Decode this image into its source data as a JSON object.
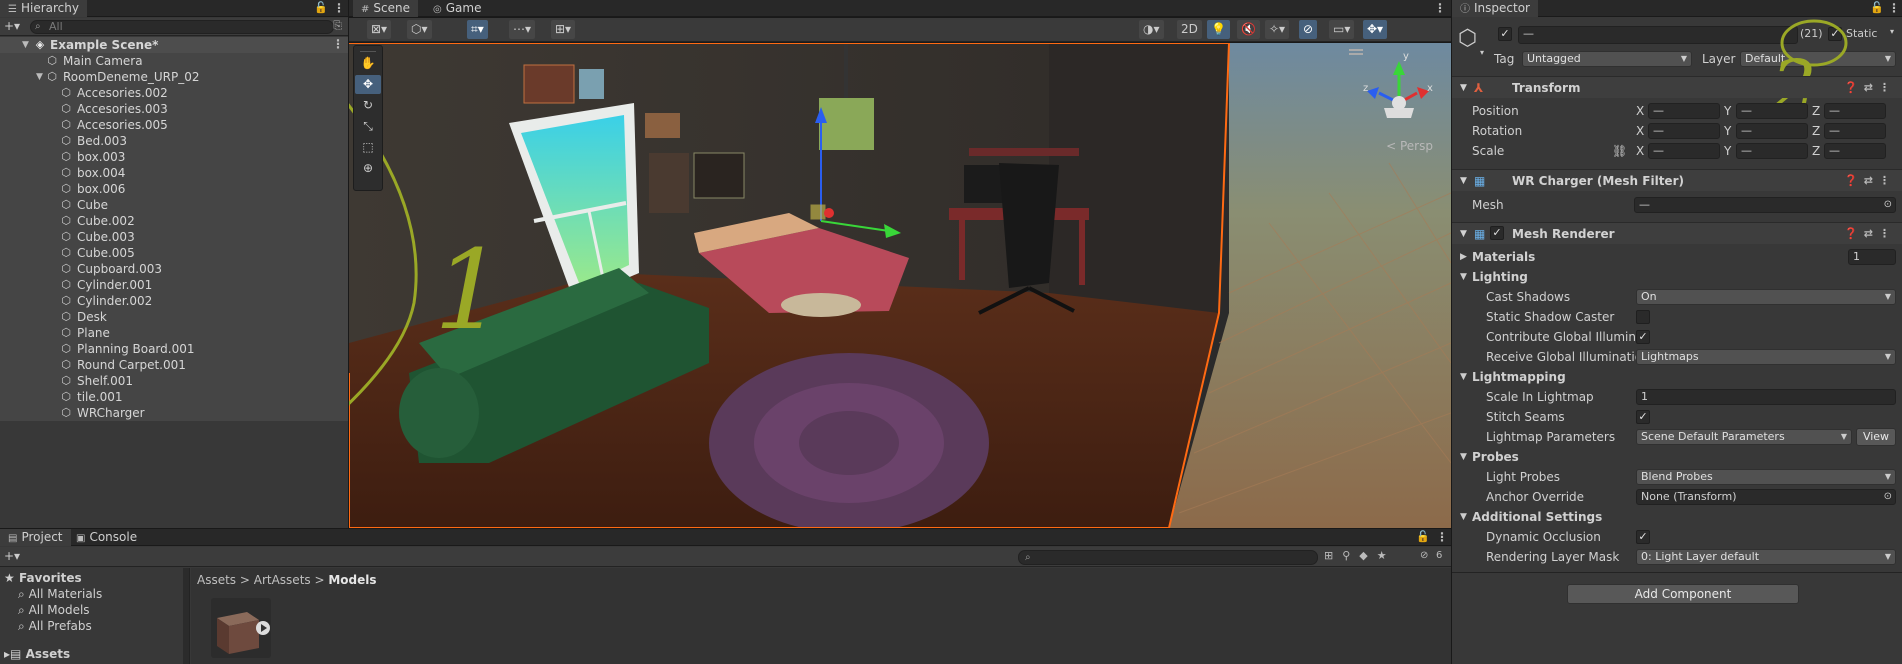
{
  "colors": {
    "accent": "#46607c",
    "selection_outline": "#ff6a13",
    "annotation": "#9aa826"
  },
  "hierarchy": {
    "tab": "Hierarchy",
    "search_placeholder": "All",
    "scene_name": "Example Scene*",
    "items": [
      "Main Camera",
      "RoomDeneme_URP_02"
    ],
    "children": [
      "Accesories.002",
      "Accesories.003",
      "Accesories.005",
      "Bed.003",
      "box.003",
      "box.004",
      "box.006",
      "Cube",
      "Cube.002",
      "Cube.003",
      "Cube.005",
      "Cupboard.003",
      "Cylinder.001",
      "Cylinder.002",
      "Desk",
      "Plane",
      "Planning Board.001",
      "Round Carpet.001",
      "Shelf.001",
      "tile.001",
      "WRCharger"
    ]
  },
  "scene": {
    "tabs": [
      "Scene",
      "Game"
    ],
    "toolbar": {
      "mode_2d": "2D"
    },
    "persp_label": "< Persp",
    "gizmo_axes": {
      "x": "x",
      "y": "y",
      "z": "z"
    },
    "annotation_1": "1",
    "annotation_2": "2"
  },
  "inspector": {
    "tab": "Inspector",
    "name_value": "—",
    "count_label": "(21)",
    "static_label": "Static",
    "tag_label": "Tag",
    "tag_value": "Untagged",
    "layer_label": "Layer",
    "layer_value": "Default",
    "transform": {
      "title": "Transform",
      "rows": [
        {
          "label": "Position",
          "x": "—",
          "y": "—",
          "z": "—"
        },
        {
          "label": "Rotation",
          "x": "—",
          "y": "—",
          "z": "—"
        },
        {
          "label": "Scale",
          "x": "—",
          "y": "—",
          "z": "—"
        }
      ],
      "axis": {
        "x": "X",
        "y": "Y",
        "z": "Z"
      }
    },
    "mesh_filter": {
      "title": "WR Charger (Mesh Filter)",
      "mesh_label": "Mesh",
      "mesh_value": "—"
    },
    "mesh_renderer": {
      "title": "Mesh Renderer",
      "materials_label": "Materials",
      "materials_count": "1",
      "lighting": "Lighting",
      "cast_shadows_label": "Cast Shadows",
      "cast_shadows_value": "On",
      "static_shadow_caster": "Static Shadow Caster",
      "contribute_gi": "Contribute Global Illuminat",
      "receive_gi": "Receive Global Illumination",
      "receive_gi_value": "Lightmaps",
      "lightmapping": "Lightmapping",
      "scale_in_lightmap": "Scale In Lightmap",
      "scale_in_lightmap_value": "1",
      "stitch_seams": "Stitch Seams",
      "lightmap_parameters": "Lightmap Parameters",
      "lightmap_parameters_value": "Scene Default Parameters",
      "view_button": "View",
      "probes": "Probes",
      "light_probes": "Light Probes",
      "light_probes_value": "Blend Probes",
      "anchor_override": "Anchor Override",
      "anchor_override_value": "None (Transform)",
      "additional_settings": "Additional Settings",
      "dynamic_occlusion": "Dynamic Occlusion",
      "rendering_layer_mask": "Rendering Layer Mask",
      "rendering_layer_mask_value": "0: Light Layer default"
    },
    "add_component": "Add Component"
  },
  "project": {
    "tabs": [
      "Project",
      "Console"
    ],
    "favorites_label": "Favorites",
    "favorites": [
      "All Materials",
      "All Models",
      "All Prefabs"
    ],
    "assets_label": "Assets",
    "breadcrumb": [
      "Assets",
      "ArtAssets",
      "Models"
    ],
    "hidden_count": "6"
  }
}
